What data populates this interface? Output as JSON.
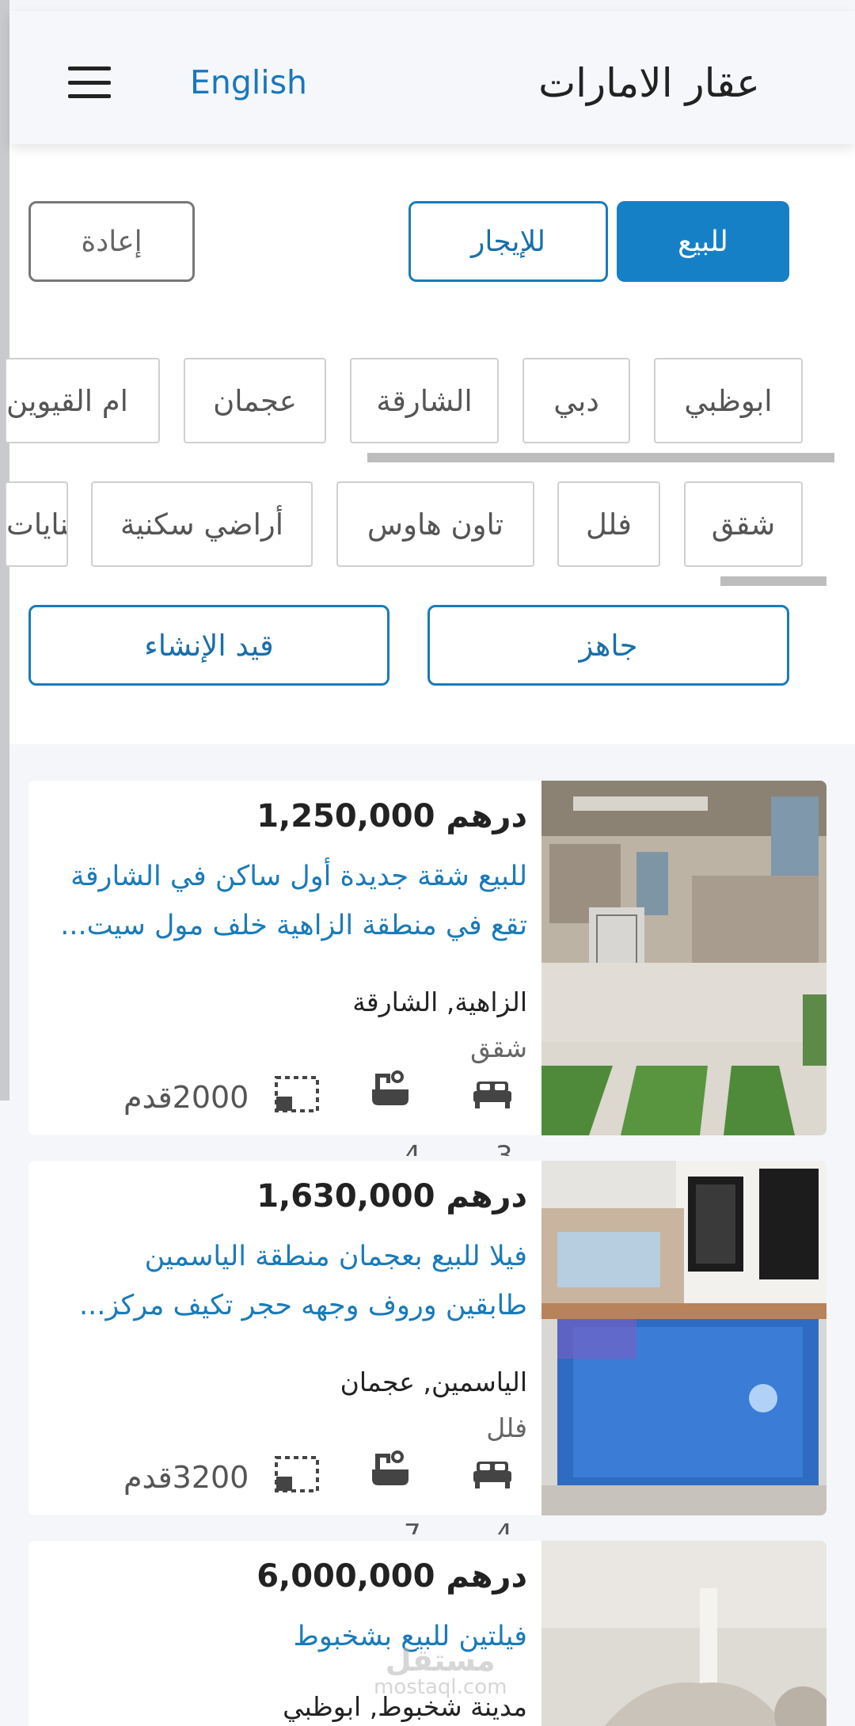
{
  "header": {
    "app_title": "عقار الامارات",
    "language_link": "English"
  },
  "filters": {
    "sale_label": "للبيع",
    "rent_label": "للإيجار",
    "reset_label": "إعادة",
    "emirates": [
      "ابوظبي",
      "دبي",
      "الشارقة",
      "عجمان",
      "ام القيوين"
    ],
    "property_types": [
      "شقق",
      "فلل",
      "تاون هاوس",
      "أراضي سكنية",
      "بنايات"
    ],
    "ready_label": "جاهز",
    "under_construction_label": "قيد الإنشاء"
  },
  "listings": [
    {
      "price": "درهم 1,250,000",
      "title_line1": "للبيع شقة جديدة أول ساكن في الشارقة",
      "title_line2": "تقع في منطقة الزاهية خلف مول سيت...",
      "location": "الزاهية, الشارقة",
      "type": "شقق",
      "area": "2000قدم",
      "bedrooms": "3",
      "bathrooms": "4"
    },
    {
      "price": "درهم 1,630,000",
      "title_line1": "فيلا للبيع بعجمان منطقة الياسمين",
      "title_line2": "طابقين وروف وجهه حجر تكيف مركز...",
      "location": "الياسمين, عجمان",
      "type": "فلل",
      "area": "3200قدم",
      "bedrooms": "4",
      "bathrooms": "7"
    },
    {
      "price": "درهم 6,000,000",
      "title_line1": "فيلتين للبيع بشخبوط",
      "location": "مدينة شخبوط, ابوظبي"
    }
  ],
  "watermark": {
    "arabic": "مستقل",
    "latin": "mostaql.com"
  },
  "icons": [
    "menu-icon",
    "bed-icon",
    "bath-icon",
    "area-icon"
  ],
  "colors": {
    "accent": "#1680c6",
    "link": "#1a7bb8",
    "background": "#f4f6f9"
  }
}
